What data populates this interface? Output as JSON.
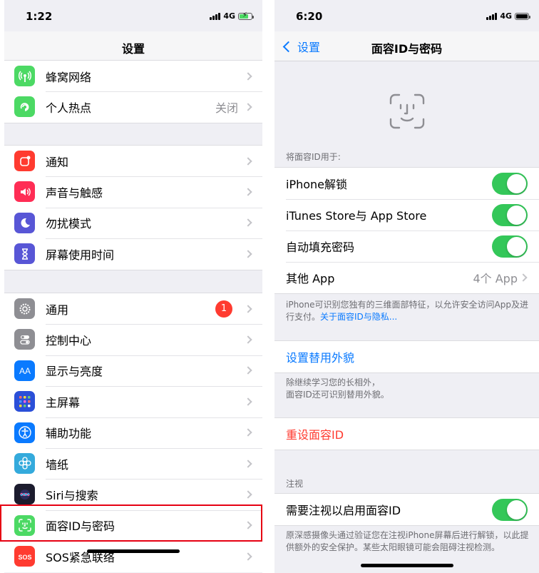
{
  "left": {
    "time": "1:22",
    "network": "4G",
    "title": "设置",
    "groups": [
      [
        {
          "label": "蜂窝网络",
          "icon": "cellular-icon",
          "color": "#4cd964"
        },
        {
          "label": "个人热点",
          "icon": "hotspot-icon",
          "color": "#4cd964",
          "value": "关闭"
        }
      ],
      [
        {
          "label": "通知",
          "icon": "notifications-icon",
          "color": "#ff3b30"
        },
        {
          "label": "声音与触感",
          "icon": "sound-icon",
          "color": "#ff2d55"
        },
        {
          "label": "勿扰模式",
          "icon": "moon-icon",
          "color": "#5856d6"
        },
        {
          "label": "屏幕使用时间",
          "icon": "hourglass-icon",
          "color": "#5856d6"
        }
      ],
      [
        {
          "label": "通用",
          "icon": "gear-icon",
          "color": "#8e8e93",
          "badge": "1"
        },
        {
          "label": "控制中心",
          "icon": "control-center-icon",
          "color": "#8e8e93"
        },
        {
          "label": "显示与亮度",
          "icon": "display-icon",
          "color": "#0a7aff"
        },
        {
          "label": "主屏幕",
          "icon": "home-screen-icon",
          "color": "#2b4fd8"
        },
        {
          "label": "辅助功能",
          "icon": "accessibility-icon",
          "color": "#0a7aff"
        },
        {
          "label": "墙纸",
          "icon": "wallpaper-icon",
          "color": "#34aadc"
        },
        {
          "label": "Siri与搜索",
          "icon": "siri-icon",
          "color": "#222"
        },
        {
          "label": "面容ID与密码",
          "icon": "faceid-icon",
          "color": "#4cd964"
        },
        {
          "label": "SOS紧急联络",
          "icon": "sos-icon",
          "color": "#ff3b30"
        }
      ]
    ]
  },
  "right": {
    "time": "6:20",
    "network": "4G",
    "back_label": "设置",
    "title": "面容ID与密码",
    "use_for_header": "将面容ID用于:",
    "toggles": [
      {
        "label": "iPhone解锁",
        "on": true
      },
      {
        "label": "iTunes Store与 App Store",
        "on": true
      },
      {
        "label": "自动填充密码",
        "on": true
      }
    ],
    "other_app": {
      "label": "其他 App",
      "value": "4个 App"
    },
    "footnote1": "iPhone可识别您独有的三维面部特征，以允许安全访问App及进行支付。",
    "footnote1_link": "关于面容ID与隐私...",
    "alt_appearance": "设置替用外貌",
    "footnote2_line1": "除继续学习您的长相外，",
    "footnote2_line2": "面容ID还可识别替用外貌。",
    "reset": "重设面容ID",
    "attention_header": "注视",
    "attention_toggle": "需要注视以启用面容ID",
    "footnote3": "原深感摄像头通过验证您在注视iPhone屏幕后进行解锁，以此提供额外的安全保护。某些太阳眼镜可能会阻碍注视检测。",
    "accent": "#0a7aff",
    "toggle_color": "#34c759",
    "destructive": "#ff3b30"
  }
}
